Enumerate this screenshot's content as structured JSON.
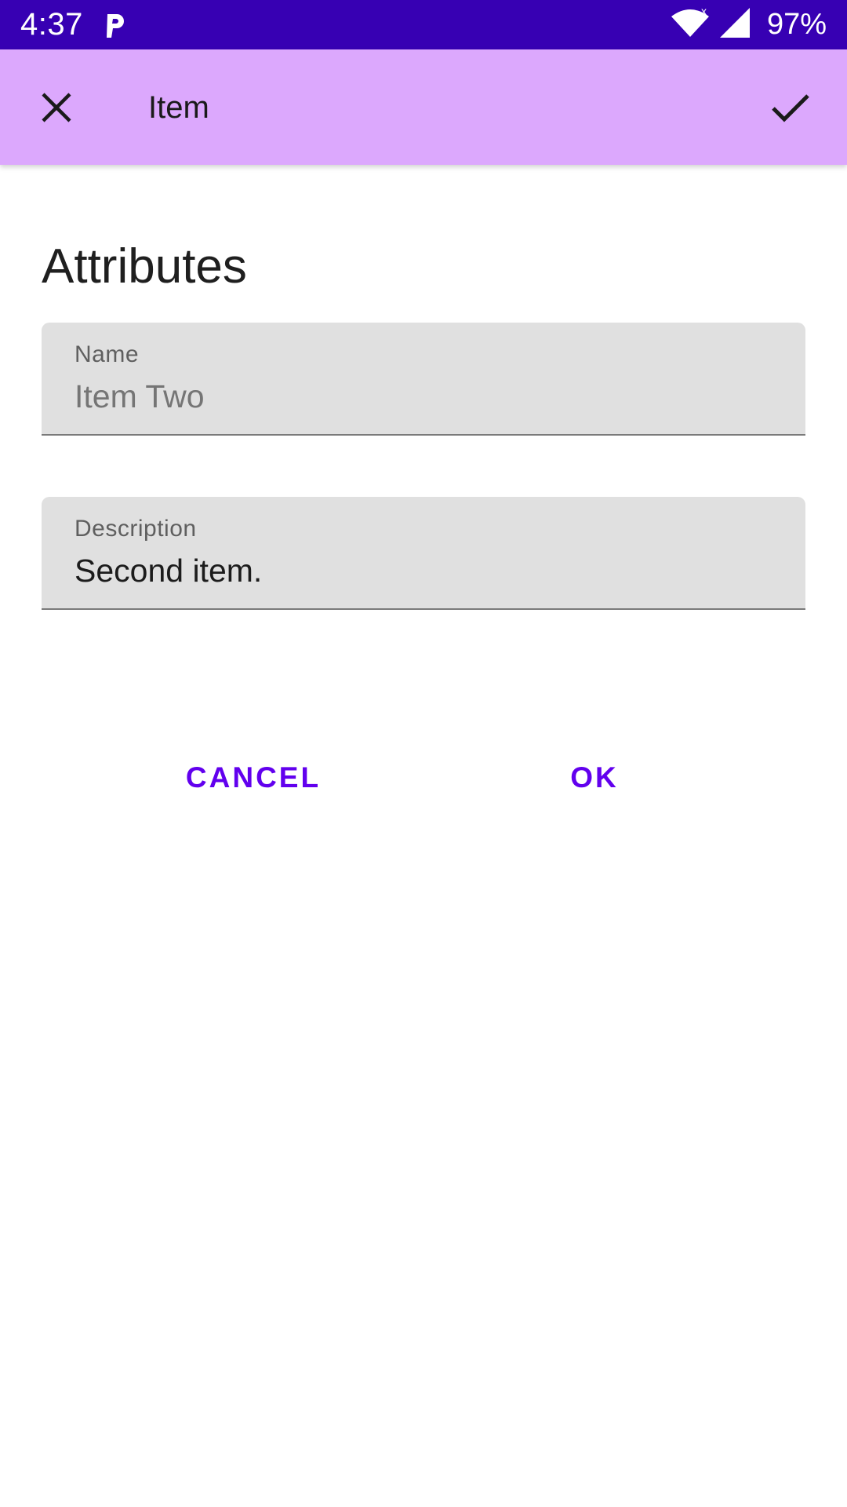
{
  "status_bar": {
    "time": "4:37",
    "battery": "97%"
  },
  "app_bar": {
    "title": "Item"
  },
  "section": {
    "title": "Attributes"
  },
  "fields": {
    "name": {
      "label": "Name",
      "placeholder": "Item Two",
      "value": ""
    },
    "description": {
      "label": "Description",
      "value": "Second item."
    }
  },
  "buttons": {
    "cancel": "CANCEL",
    "ok": "OK"
  },
  "colors": {
    "status_bar": "#3700b3",
    "app_bar": "#dca8fd",
    "accent": "#6200ee",
    "field_bg": "#e0e0e0"
  },
  "icons": {
    "close": "close-icon",
    "check": "check-icon",
    "app_notification": "p-notification-icon",
    "wifi": "wifi-icon",
    "signal": "signal-icon"
  }
}
